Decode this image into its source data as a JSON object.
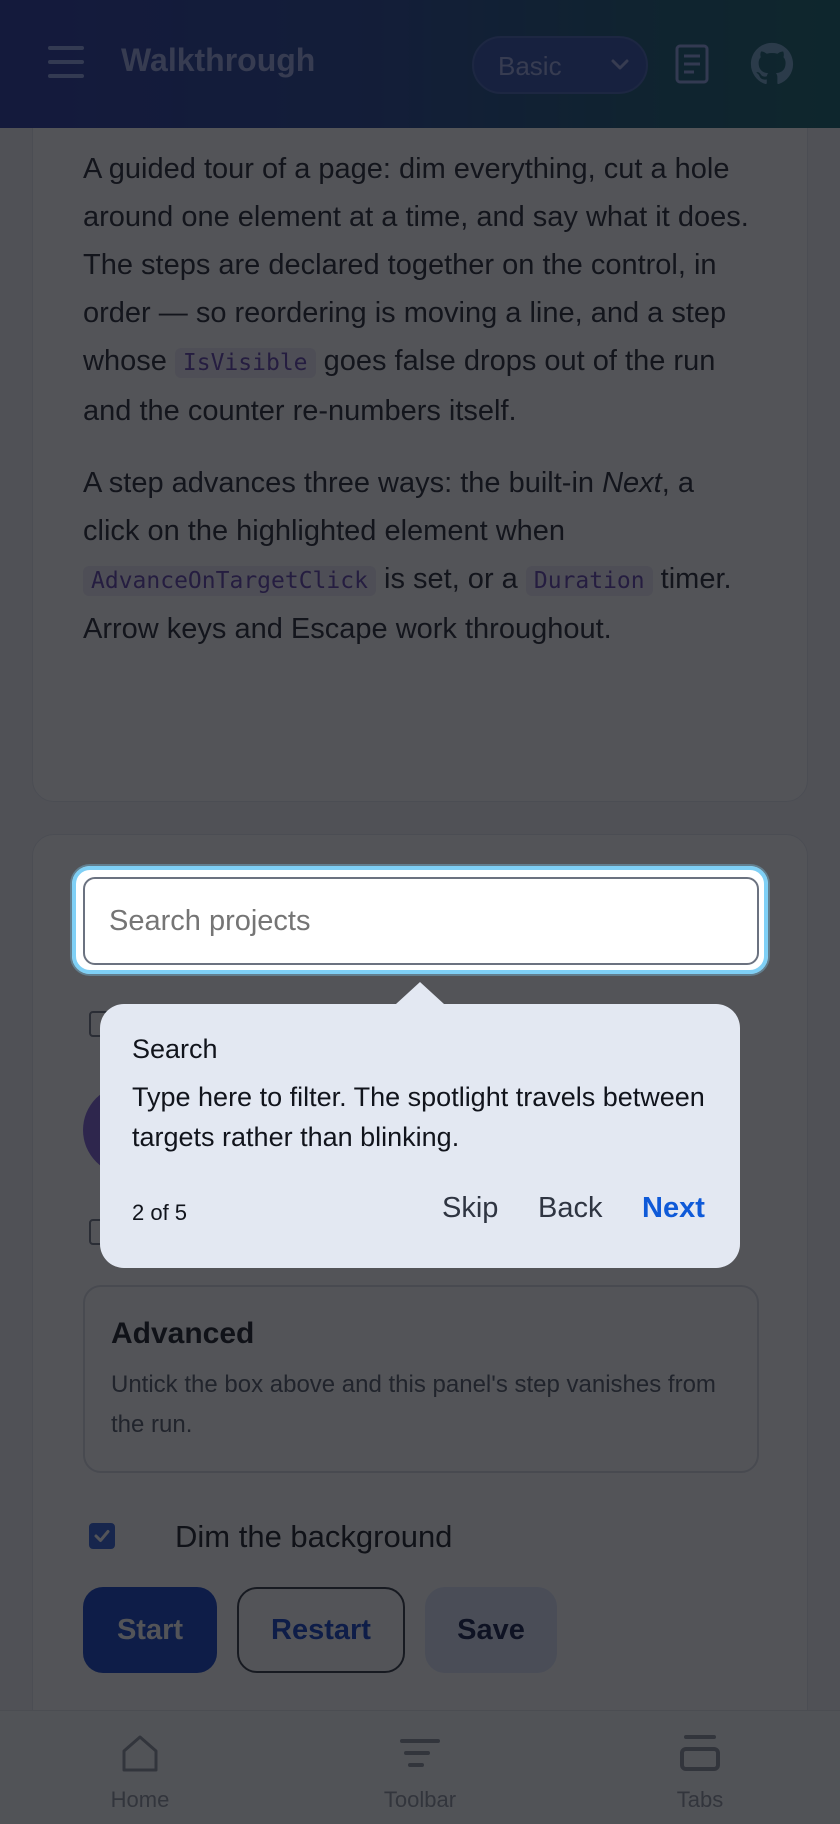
{
  "header": {
    "title": "Walkthrough",
    "variant_select": {
      "selected": "Basic"
    },
    "icons": {
      "menu": "menu-icon",
      "docs": "document-icon",
      "repo": "github-icon"
    },
    "gradient_colors": [
      "#1e2f9c",
      "#0a5c64"
    ]
  },
  "intro": {
    "para1": {
      "text_a": "A guided tour of a page: dim everything, cut a hole around one element at a time, and say what it does. The steps are declared together on the control, in order — so reordering is moving a line, and a step whose ",
      "code": "IsVisible",
      "text_b": " goes false drops out of the run and the counter re-numbers itself."
    },
    "para2": {
      "text_a": "A step advances three ways: the built-in ",
      "emph": "Next",
      "text_b": ", a click on the highlighted element when ",
      "code1": "AdvanceOnTargetClick",
      "text_c": " is set, or a ",
      "code2": "Duration",
      "text_d": " timer. Arrow keys and Escape work throughout."
    }
  },
  "demo": {
    "search": {
      "placeholder": "Search projects",
      "value": ""
    },
    "advanced": {
      "title": "Advanced",
      "text": "Untick the box above and this panel's step vanishes from the run."
    },
    "dim_background": {
      "label": "Dim the background",
      "checked": true
    },
    "buttons": {
      "start": "Start",
      "restart": "Restart",
      "save": "Save"
    },
    "accent_color": "#0a3bc4"
  },
  "tour": {
    "step_title": "Search",
    "step_body": "Type here to filter. The spotlight travels between targets rather than blinking.",
    "counter": "2 of 5",
    "skip": "Skip",
    "back": "Back",
    "next": "Next",
    "highlight_color": "#7fd0f6"
  },
  "bottom_nav": {
    "items": [
      {
        "label": "Home",
        "icon": "home-icon"
      },
      {
        "label": "Toolbar",
        "icon": "toolbar-icon"
      },
      {
        "label": "Tabs",
        "icon": "tabs-icon"
      }
    ]
  }
}
